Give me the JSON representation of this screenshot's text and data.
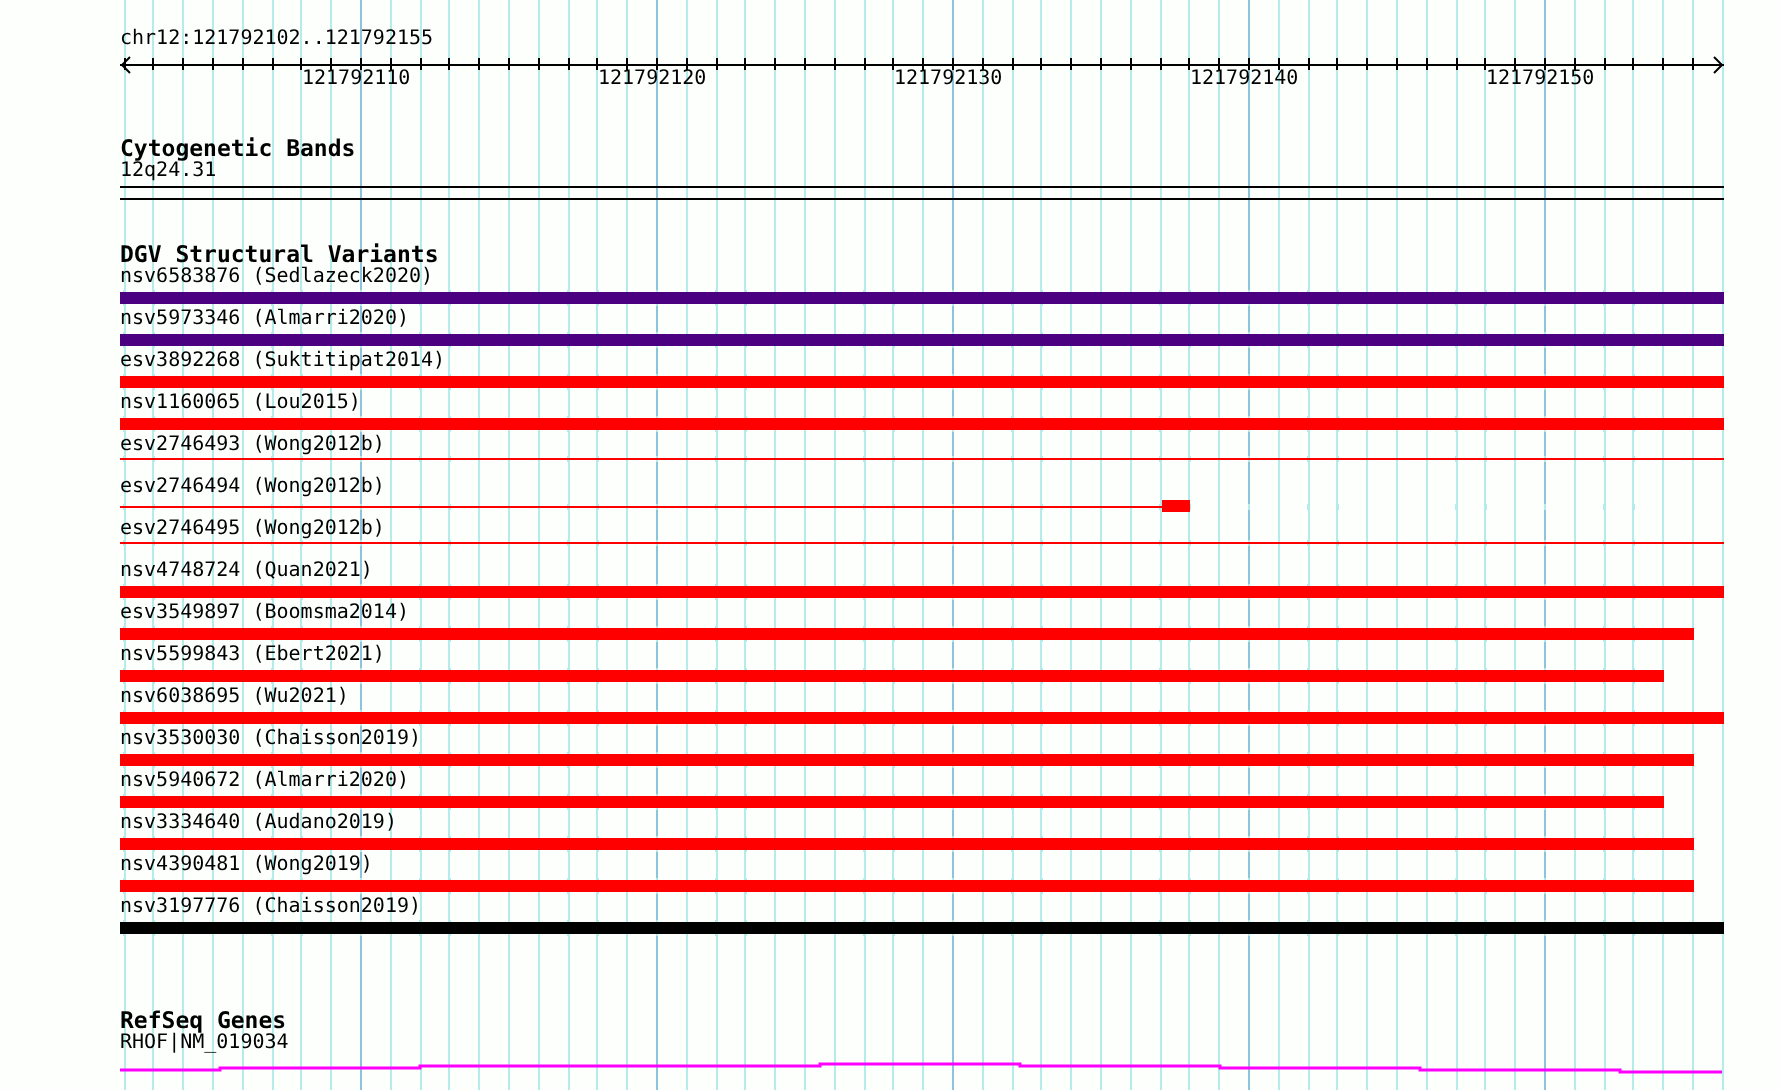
{
  "ruler": {
    "location": "chr12:121792102..121792155",
    "ticks": [
      "121792110",
      "121792120",
      "121792130",
      "121792140",
      "121792150"
    ]
  },
  "tracks": [
    {
      "kind": "cytoband",
      "title": "Cytogenetic Bands",
      "label": "12q24.31"
    },
    {
      "kind": "variants",
      "title": "DGV Structural Variants",
      "features": [
        {
          "label": "nsv6583876 (Sedlazeck2020)",
          "kind": "thick",
          "color": "#4b0082",
          "level": 1
        },
        {
          "label": "nsv5973346 (Almarri2020)",
          "kind": "thick",
          "color": "#4b0082",
          "level": 1
        },
        {
          "label": "esv3892268 (Suktitipat2014)",
          "kind": "thick",
          "color": "#ff0000",
          "level": 1
        },
        {
          "label": "nsv1160065 (Lou2015)",
          "kind": "thick",
          "color": "#ff0000",
          "level": 1
        },
        {
          "label": "esv2746493 (Wong2012b)",
          "kind": "thin",
          "color": "#ff0000",
          "level": 1
        },
        {
          "label": "esv2746494 (Wong2012b)",
          "kind": "split",
          "color": "#ff0000",
          "level": 0.667
        },
        {
          "label": "esv2746495 (Wong2012b)",
          "kind": "thin",
          "color": "#ff0000",
          "level": 1
        },
        {
          "label": "nsv4748724 (Quan2021)",
          "kind": "thick",
          "color": "#ff0000",
          "level": 1
        },
        {
          "label": "esv3549897 (Boomsma2014)",
          "kind": "thick",
          "color": "#ff0000",
          "level": 0.981
        },
        {
          "label": "nsv5599843 (Ebert2021)",
          "kind": "thick",
          "color": "#ff0000",
          "level": 0.963
        },
        {
          "label": "nsv6038695 (Wu2021)",
          "kind": "thick",
          "color": "#ff0000",
          "level": 1
        },
        {
          "label": "nsv3530030 (Chaisson2019)",
          "kind": "thick",
          "color": "#ff0000",
          "level": 0.981
        },
        {
          "label": "nsv5940672 (Almarri2020)",
          "kind": "thick",
          "color": "#ff0000",
          "level": 0.963
        },
        {
          "label": "nsv3334640 (Audano2019)",
          "kind": "thick",
          "color": "#ff0000",
          "level": 0.981
        },
        {
          "label": "nsv4390481 (Wong2019)",
          "kind": "thick",
          "color": "#ff0000",
          "level": 0.981
        },
        {
          "label": "nsv3197776 (Chaisson2019)",
          "kind": "thick",
          "color": "#000000",
          "level": 1
        }
      ]
    },
    {
      "kind": "genes",
      "title": "RefSeq Genes",
      "label": "RHOF|NM_019034"
    }
  ]
}
